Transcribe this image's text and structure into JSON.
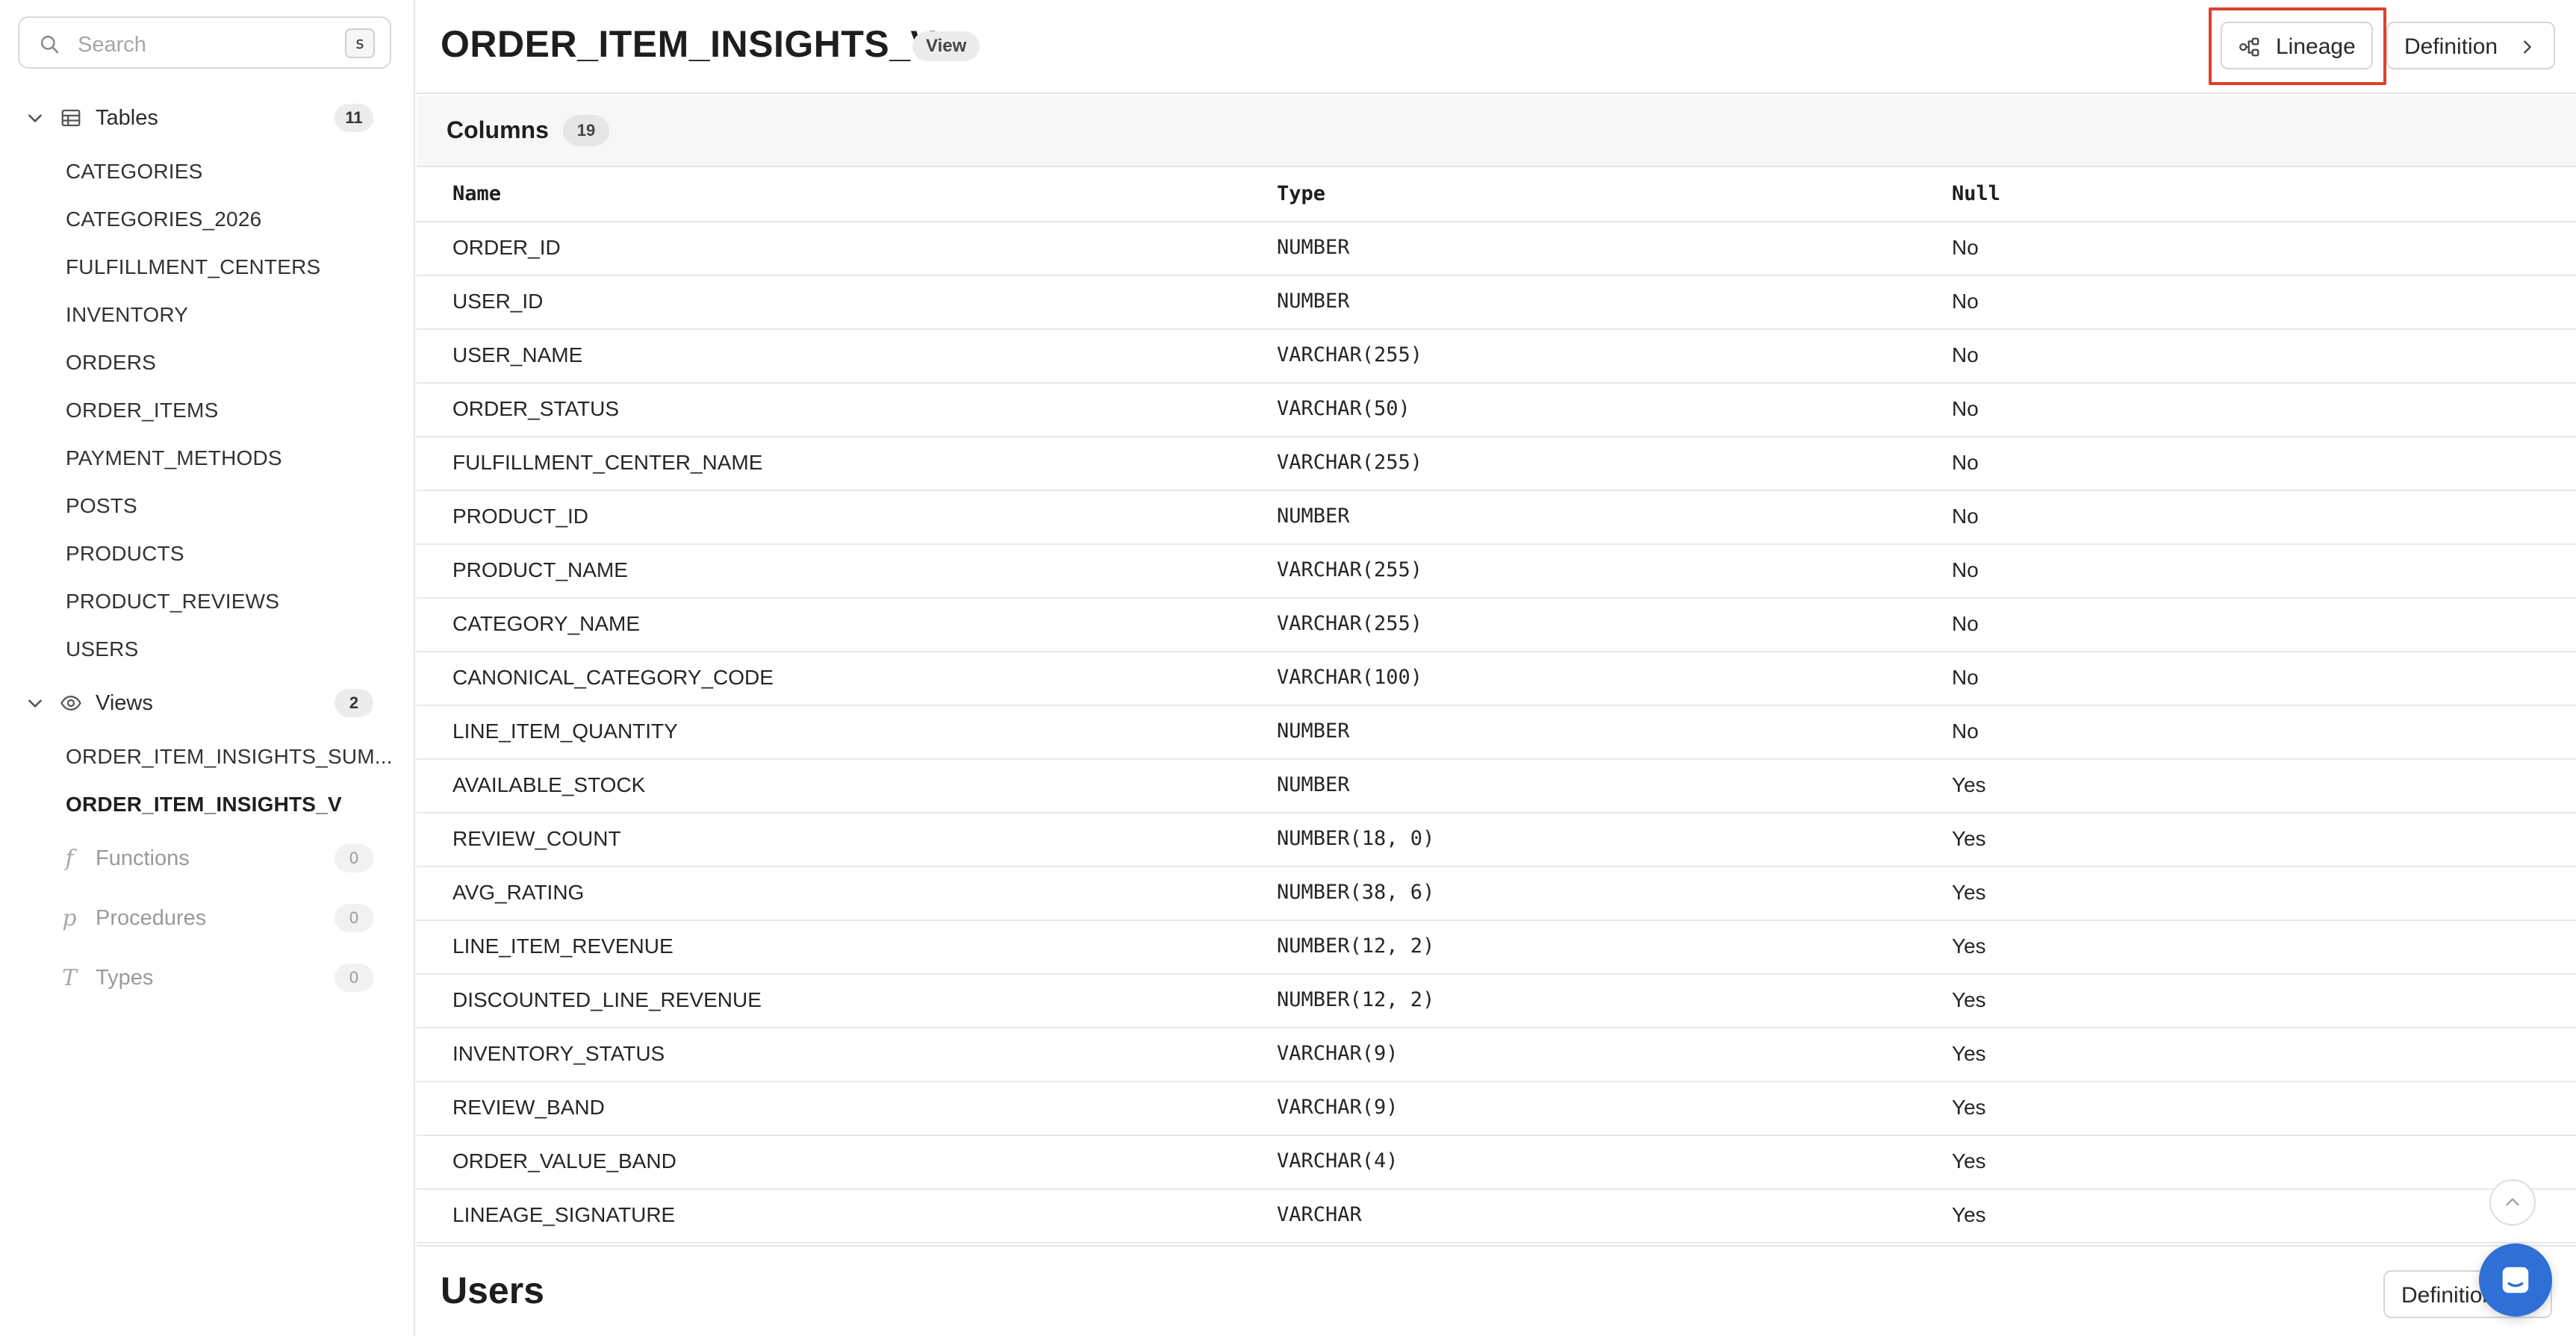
{
  "sidebar": {
    "search": {
      "placeholder": "Search",
      "shortcut": "s"
    },
    "tables": {
      "label": "Tables",
      "count": "11",
      "items": [
        "CATEGORIES",
        "CATEGORIES_2026",
        "FULFILLMENT_CENTERS",
        "INVENTORY",
        "ORDERS",
        "ORDER_ITEMS",
        "PAYMENT_METHODS",
        "POSTS",
        "PRODUCTS",
        "PRODUCT_REVIEWS",
        "USERS"
      ]
    },
    "views": {
      "label": "Views",
      "count": "2",
      "items": [
        "ORDER_ITEM_INSIGHTS_SUM...",
        "ORDER_ITEM_INSIGHTS_V"
      ],
      "active_index": 1
    },
    "functions": {
      "label": "Functions",
      "count": "0",
      "letter": "f"
    },
    "procedures": {
      "label": "Procedures",
      "count": "0",
      "letter": "p"
    },
    "types": {
      "label": "Types",
      "count": "0",
      "letter": "T"
    }
  },
  "header": {
    "title": "ORDER_ITEM_INSIGHTS_V",
    "badge": "View",
    "lineage_label": "Lineage",
    "definition_label": "Definition"
  },
  "columns": {
    "title": "Columns",
    "count": "19",
    "headers": {
      "name": "Name",
      "type": "Type",
      "null": "Null"
    },
    "rows": [
      {
        "name": "ORDER_ID",
        "type": "NUMBER",
        "null": "No"
      },
      {
        "name": "USER_ID",
        "type": "NUMBER",
        "null": "No"
      },
      {
        "name": "USER_NAME",
        "type": "VARCHAR(255)",
        "null": "No"
      },
      {
        "name": "ORDER_STATUS",
        "type": "VARCHAR(50)",
        "null": "No"
      },
      {
        "name": "FULFILLMENT_CENTER_NAME",
        "type": "VARCHAR(255)",
        "null": "No"
      },
      {
        "name": "PRODUCT_ID",
        "type": "NUMBER",
        "null": "No"
      },
      {
        "name": "PRODUCT_NAME",
        "type": "VARCHAR(255)",
        "null": "No"
      },
      {
        "name": "CATEGORY_NAME",
        "type": "VARCHAR(255)",
        "null": "No"
      },
      {
        "name": "CANONICAL_CATEGORY_CODE",
        "type": "VARCHAR(100)",
        "null": "No"
      },
      {
        "name": "LINE_ITEM_QUANTITY",
        "type": "NUMBER",
        "null": "No"
      },
      {
        "name": "AVAILABLE_STOCK",
        "type": "NUMBER",
        "null": "Yes"
      },
      {
        "name": "REVIEW_COUNT",
        "type": "NUMBER(18, 0)",
        "null": "Yes"
      },
      {
        "name": "AVG_RATING",
        "type": "NUMBER(38, 6)",
        "null": "Yes"
      },
      {
        "name": "LINE_ITEM_REVENUE",
        "type": "NUMBER(12, 2)",
        "null": "Yes"
      },
      {
        "name": "DISCOUNTED_LINE_REVENUE",
        "type": "NUMBER(12, 2)",
        "null": "Yes"
      },
      {
        "name": "INVENTORY_STATUS",
        "type": "VARCHAR(9)",
        "null": "Yes"
      },
      {
        "name": "REVIEW_BAND",
        "type": "VARCHAR(9)",
        "null": "Yes"
      },
      {
        "name": "ORDER_VALUE_BAND",
        "type": "VARCHAR(4)",
        "null": "Yes"
      },
      {
        "name": "LINEAGE_SIGNATURE",
        "type": "VARCHAR",
        "null": "Yes"
      }
    ]
  },
  "next_section": {
    "title": "Users",
    "definition_label": "Definition"
  },
  "colors": {
    "highlight": "#e0402a",
    "chat_button": "#2f6fd6",
    "badge_bg": "#ececec"
  },
  "icons": {
    "search": "search-icon",
    "tables": "table-icon",
    "views": "eye-icon",
    "lineage": "lineage-icon",
    "chevron": "chevron-right-icon",
    "scroll_top": "chevron-up-icon",
    "chat": "chat-icon"
  }
}
